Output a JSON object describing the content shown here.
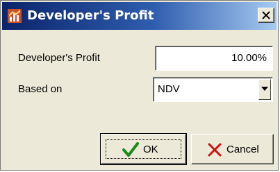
{
  "window": {
    "title": "Developer's Profit",
    "close_glyph": "×"
  },
  "form": {
    "profit_label": "Developer's Profit",
    "profit_value": "10.00%",
    "based_on_label": "Based on",
    "based_on_value": "NDV"
  },
  "buttons": {
    "ok_label": "OK",
    "cancel_label": "Cancel"
  },
  "icons": {
    "app": "app-icon",
    "close": "close-icon",
    "dropdown": "chevron-down-icon",
    "ok": "checkmark-icon",
    "cancel": "x-mark-icon"
  },
  "colors": {
    "title_gradient_start": "#0a246a",
    "title_gradient_end": "#a6caf0",
    "ok_check": "#1a8a1a",
    "cancel_x": "#d01010"
  }
}
